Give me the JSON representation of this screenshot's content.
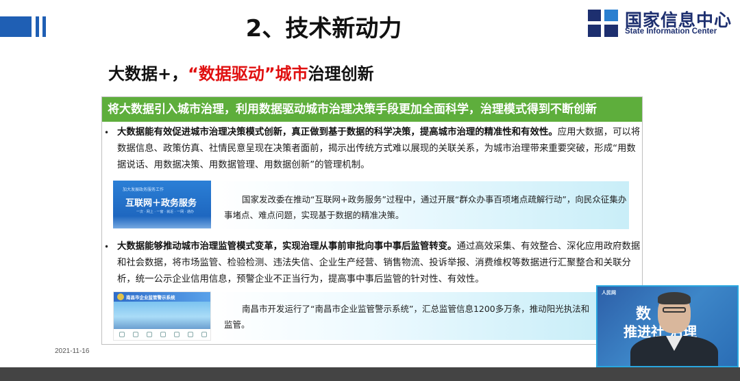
{
  "slide": {
    "title": "2、技术新动力",
    "logo": {
      "cn": "国家信息中心",
      "en": "State Information Center"
    },
    "subtitle": {
      "part1": "大数据+，",
      "part2": "“数据驱动”城市",
      "part3": "治理创新"
    },
    "banner": "将大数据引入城市治理，利用数据驱动城市治理决策手段更加全面科学，治理模式得到不断创新",
    "bullets": [
      {
        "marker": "•",
        "bold": "大数据能有效促进城市治理决策模式创新，真正做到基于数据的科学决策，提高城市治理的精准性和有效性。",
        "text": "应用大数据，可以将数据信息、政策仿真、社情民意呈现在决策者面前，揭示出传统方式难以展现的关联关系，为城市治理带来重要突破，形成“用数据说话、用数据决策、用数据管理、用数据创新”的管理机制。"
      },
      {
        "marker": "•",
        "bold": "大数据能够推动城市治理监管模式变革，实现治理从事前审批向事中事后监管转变。",
        "text": "通过高效采集、有效整合、深化应用政府数据和社会数据，将市场监管、检验检测、违法失信、企业生产经营、销售物流、投诉举报、消费维权等数据进行汇聚整合和关联分析，统一公示企业信用信息，预警企业不正当行为，提高事中事后监管的针对性、有效性。"
      }
    ],
    "cases": [
      {
        "text": "国家发改委在推动“互联网+政务服务”过程中，通过开展“群众办事百项堵点疏解行动”，向民众征集办事堵点、难点问题，实现基于数据的精准决策。",
        "thumb_small": "加大发展政务服务工作",
        "thumb_big": "互联网＋政务服务",
        "thumb_sub": "一次  ·  网上  ·  一窗  ·  就近  ·  一网  ·  通办"
      },
      {
        "text": "南昌市开发运行了“南昌市企业监管警示系统”，汇总监管信息1200多万条，推动阳光执法和监管。",
        "thumb_header": "南昌市企业监管警示系统"
      }
    ],
    "date": "2021-11-16"
  },
  "webcam": {
    "logo": "人民网",
    "text1": "数  ",
    "text2": "推进社  治理"
  }
}
